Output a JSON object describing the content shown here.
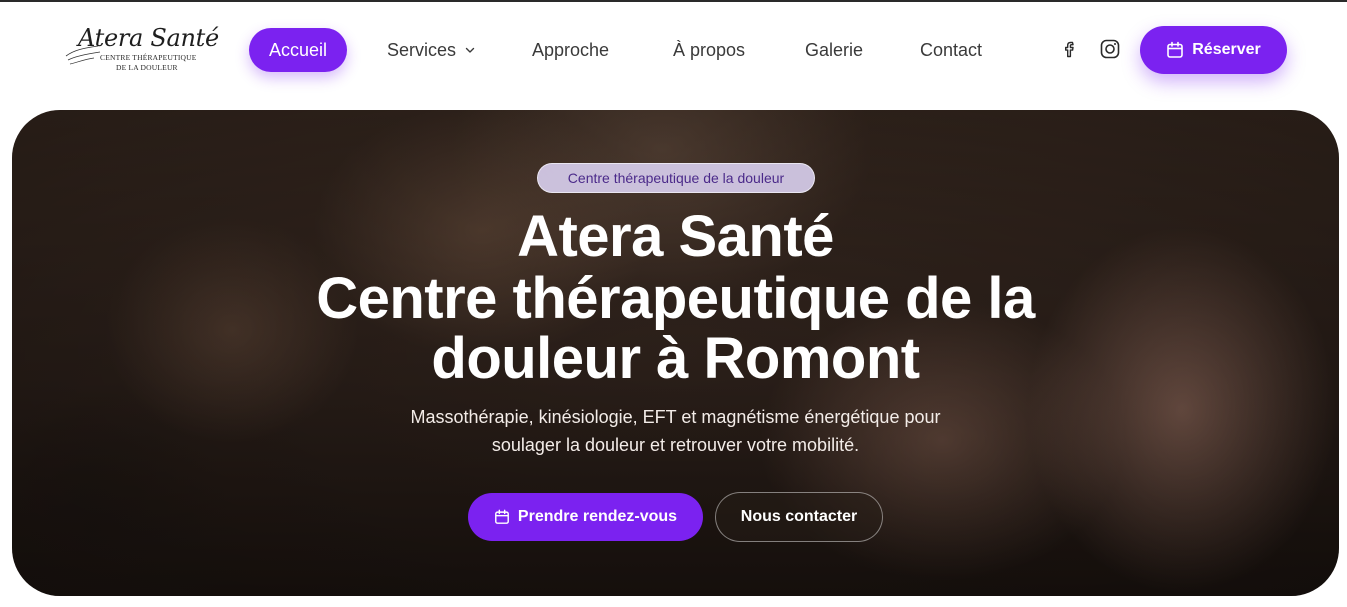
{
  "logo": {
    "title": "Atera Santé",
    "subtitle_line1": "CENTRE THÉRAPEUTIQUE",
    "subtitle_line2": "DE LA DOULEUR"
  },
  "nav": {
    "items": [
      {
        "label": "Accueil",
        "active": true
      },
      {
        "label": "Services",
        "has_dropdown": true
      },
      {
        "label": "Approche"
      },
      {
        "label": "À propos"
      },
      {
        "label": "Galerie"
      },
      {
        "label": "Contact"
      }
    ]
  },
  "social": {
    "icons": [
      "facebook-icon",
      "instagram-icon"
    ]
  },
  "header_cta": {
    "label": "Réserver",
    "icon": "calendar-icon"
  },
  "hero": {
    "badge": "Centre thérapeutique de la douleur",
    "title_lines": [
      "Atera Santé",
      "Centre thérapeutique de la",
      "douleur à Romont"
    ],
    "subtitle_lines": [
      "Massothérapie, kinésiologie, EFT et magnétisme énergétique pour",
      "soulager la douleur et retrouver votre mobilité."
    ],
    "primary_cta": "Prendre rendez-vous",
    "secondary_cta": "Nous contacter"
  },
  "colors": {
    "accent": "#7b22f0",
    "badge_bg": "#d7cdeb",
    "badge_text": "#4b2a8a",
    "hero_dark": "#2c201a"
  }
}
